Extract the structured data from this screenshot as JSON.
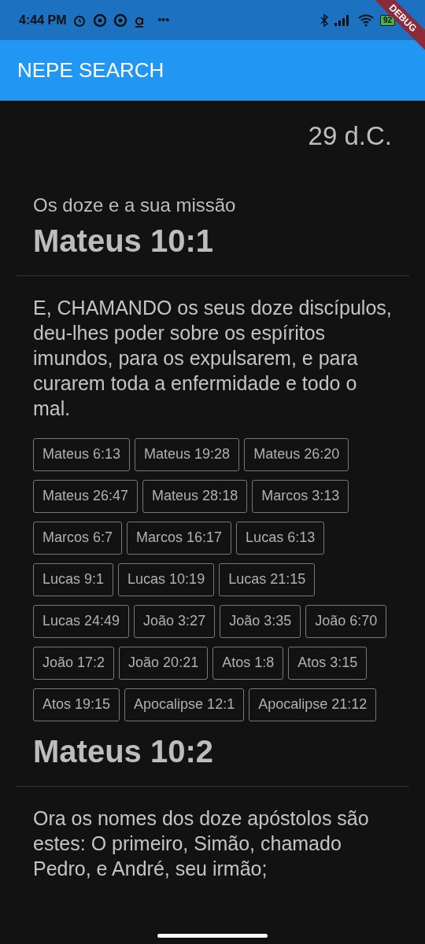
{
  "status_bar": {
    "time": "4:44 PM",
    "more": "•••",
    "battery": "92"
  },
  "debug_banner": "DEBUG",
  "app_bar": {
    "title": "NEPE SEARCH"
  },
  "date": "29 d.C.",
  "sections": [
    {
      "heading": "Os doze e a sua missão",
      "reference": "Mateus 10:1",
      "text": "E, CHAMANDO os seus doze discípulos, deu-lhes poder sobre os espíritos imundos, para os expulsarem, e para curarem toda a enfermidade e todo o mal.",
      "cross_references": [
        "Mateus 6:13",
        "Mateus 19:28",
        "Mateus 26:20",
        "Mateus 26:47",
        "Mateus 28:18",
        "Marcos 3:13",
        "Marcos 6:7",
        "Marcos 16:17",
        "Lucas 6:13",
        "Lucas 9:1",
        "Lucas 10:19",
        "Lucas 21:15",
        "Lucas 24:49",
        "João 3:27",
        "João 3:35",
        "João 6:70",
        "João 17:2",
        "João 20:21",
        "Atos 1:8",
        "Atos 3:15",
        "Atos 19:15",
        "Apocalipse 12:1",
        "Apocalipse 21:12"
      ]
    },
    {
      "reference": "Mateus 10:2",
      "text": "Ora os nomes dos doze apóstolos são estes: O primeiro, Simão, chamado Pedro, e André, seu irmão;"
    }
  ]
}
